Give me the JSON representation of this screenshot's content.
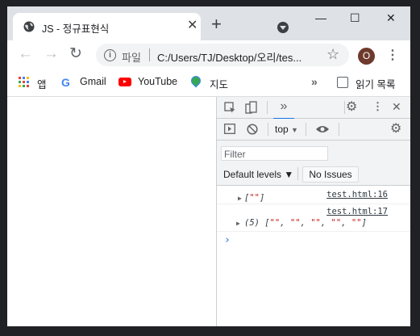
{
  "tab": {
    "title": "JS - 정규표현식",
    "close": "✕"
  },
  "newtab": "+",
  "window_controls": {
    "minimize": "—",
    "maximize": "☐",
    "close": "✕"
  },
  "toolbar": {
    "back": "←",
    "forward": "→",
    "reload": "↻",
    "protocol_label": "파일",
    "url": "C:/Users/TJ/Desktop/오리/tes...",
    "star": "☆",
    "avatar": "O",
    "menu": "⋮"
  },
  "bookmarks": {
    "apps": "앱",
    "gmail": "Gmail",
    "youtube": "YouTube",
    "maps": "지도",
    "more": "»",
    "reading_list": "읽기 목록"
  },
  "devtools": {
    "tabs_more": "»",
    "top_context": "top",
    "filter_placeholder": "Filter",
    "default_levels": "Default levels ▼",
    "no_issues": "No Issues",
    "messages": [
      {
        "source": "test.html:16",
        "value": "[\"\"]"
      },
      {
        "source": "test.html:17",
        "value": "(5) [\"\", \"\", \"\", \"\", \"\"]"
      }
    ],
    "prompt": "›"
  },
  "colors": {
    "accent": "#1a73e8",
    "string": "#c41a16",
    "tabstrip": "#dee1e6",
    "avatar": "#6d3a2d"
  }
}
